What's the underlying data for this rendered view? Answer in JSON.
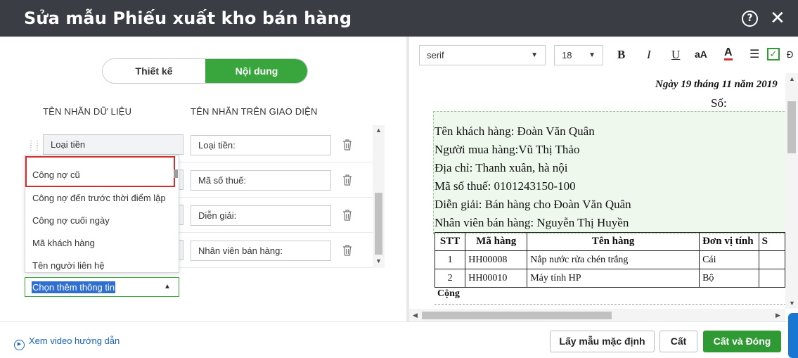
{
  "title": "Sửa mẫu Phiếu xuất kho bán hàng",
  "tabs": [
    {
      "label": "Thiết kế",
      "active": false
    },
    {
      "label": "Nội dung",
      "active": true
    }
  ],
  "columns": {
    "data_label": "TÊN NHÃN DỮ LIỆU",
    "ui_label": "TÊN NHÃN TRÊN GIAO DIỆN"
  },
  "rows": [
    {
      "data_label": "Loại tiền",
      "ui_label": "Loại tiền:"
    },
    {
      "data_label": "",
      "ui_label": "Mã số thuế:"
    },
    {
      "data_label": "",
      "ui_label": "Diễn giải:"
    },
    {
      "data_label": "",
      "ui_label": "Nhân viên bán hàng:"
    }
  ],
  "dropdown": {
    "options": [
      "Công nợ cũ",
      "Công nợ đến trước thời điểm lập",
      "Công nợ cuối ngày",
      "Mã khách hàng",
      "Tên người liên hệ"
    ],
    "highlighted_index": 0
  },
  "add_select": {
    "value": "Chọn thêm thông tin"
  },
  "toolbar": {
    "font": "serif",
    "size": "18",
    "bold": "B",
    "italic": "I",
    "underline": "U",
    "case": "aA",
    "color": "A",
    "align": "☰",
    "check_label": "Đ"
  },
  "document": {
    "date": "Ngày 19 tháng 11 năm 2019",
    "number_label": "Số:",
    "info_lines": [
      "Tên khách hàng: Đoàn Văn Quân",
      "Người mua hàng:Vũ Thị Thảo",
      "Địa chỉ: Thanh xuân, hà nội",
      "Mã số thuế: 0101243150-100",
      "Diễn giải: Bán hàng cho Đoàn Văn Quân",
      "Nhân viên bán hàng: Nguyễn Thị Huyền"
    ],
    "table_headers": [
      "STT",
      "Mã hàng",
      "Tên hàng",
      "Đơn vị tính",
      "S"
    ],
    "table_rows": [
      [
        "1",
        "HH00008",
        "Nắp nước rửa chén trắng",
        "Cái",
        ""
      ],
      [
        "2",
        "HH00010",
        "Máy tính HP",
        "Bộ",
        ""
      ]
    ],
    "total_label": "Cộng"
  },
  "footer": {
    "video_link": "Xem video hướng dẫn",
    "default_button": "Lấy mẫu mặc định",
    "save_button": "Cất",
    "save_close_button": "Cất và Đóng"
  }
}
